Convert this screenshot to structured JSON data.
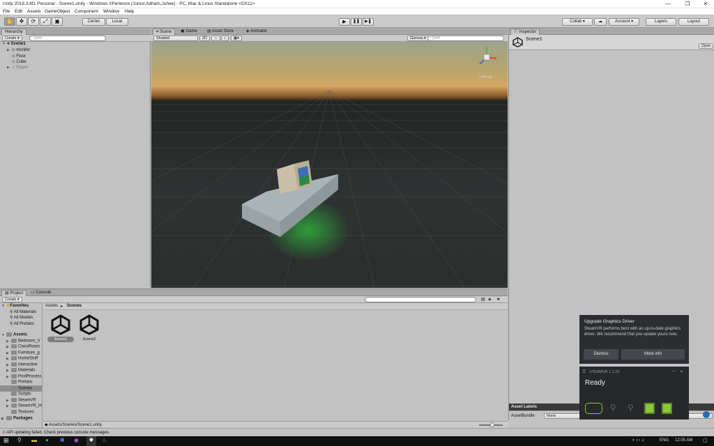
{
  "window": {
    "title": "Unity 2018.3.6f1 Personal - Scene1.unity - Windows XPerience (Junior,Adham,Juhee) - PC, Mac & Linux Standalone <DX11>",
    "min": "—",
    "max": "❐",
    "close": "✕"
  },
  "menu": [
    "File",
    "Edit",
    "Assets",
    "GameObject",
    "Component",
    "Window",
    "Help"
  ],
  "toolbar": {
    "tools": [
      "✋",
      "✥",
      "⟳",
      "⤢",
      "▣"
    ],
    "pivot": "Center",
    "space": "Local",
    "play": "▶",
    "pause": "❚❚",
    "step": "▶❚",
    "collab": "Collab ▾",
    "cloud": "☁",
    "account": "Account ▾",
    "layers": "Layers",
    "layout": "Layout"
  },
  "hierarchy": {
    "tab": "Hierarchy",
    "create": "Create ▾",
    "search": "Q▾All",
    "scene": "Scene1",
    "items": [
      "monitor",
      "Floor",
      "Cube",
      "Player"
    ]
  },
  "scene_view": {
    "tabs": [
      "Scene",
      "Game",
      "Asset Store",
      "Animator"
    ],
    "shading": "Shaded",
    "mode2d": "2D",
    "gizmos": "Gizmos ▾",
    "search": "Q▾All",
    "persp": "≤ Persp"
  },
  "inspector": {
    "tab": "Inspector",
    "object": "Scene1",
    "open": "Open",
    "asset_labels": "Asset Labels",
    "assetbundle": "AssetBundle",
    "none1": "None",
    "none2": "None"
  },
  "project": {
    "tabs": [
      "Project",
      "Console"
    ],
    "create": "Create ▾",
    "breadcrumb_root": "Assets",
    "breadcrumb_sep": "▸",
    "breadcrumb_leaf": "Scenes",
    "favorites": "Favorites",
    "fav_items": [
      "All Materials",
      "All Models",
      "All Prefabs"
    ],
    "assets": "Assets",
    "folders": [
      "Bedroom_V",
      "ClassRoom",
      "Furniture_g",
      "HomeStuff",
      "Interactive",
      "Materials",
      "PostProcess",
      "Prefabs",
      "Scenes",
      "Scripts",
      "SteamVR",
      "SteamVR_In",
      "Textures"
    ],
    "packages": "Packages",
    "files": [
      "Scene1",
      "Scene2"
    ],
    "path": "Assets/Scenes/Scene1.unity"
  },
  "status": {
    "message": "API updating failed. Check previous console messages."
  },
  "notification": {
    "title": "Upgrade Graphics Driver",
    "body": "SteamVR performs best with an up-to-date graphics driver. We recommend that you update yours now.",
    "dismiss": "Dismiss",
    "more": "More info"
  },
  "steamvr": {
    "version": "STEAMVR 1.3.23",
    "status": "Ready"
  },
  "taskbar": {
    "time": "12:05 AM",
    "lang": "ENG"
  }
}
